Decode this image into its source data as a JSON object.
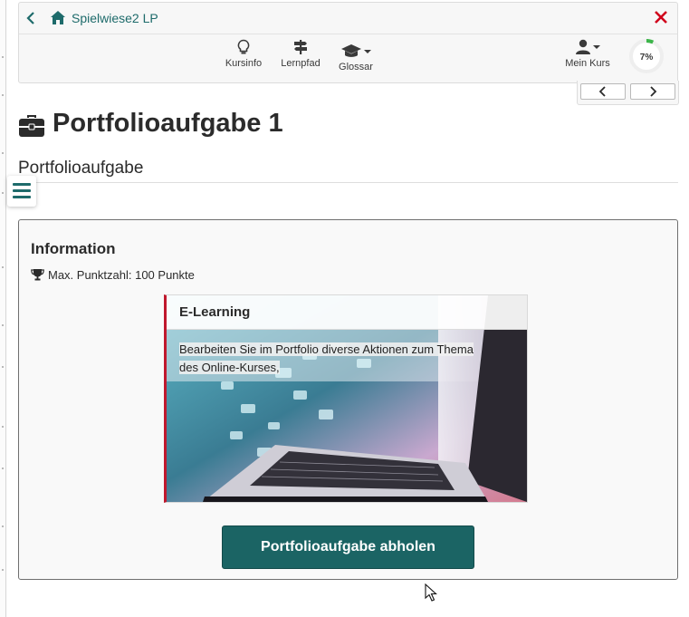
{
  "header": {
    "course_title": "Spielwiese2 LP",
    "toolbar": [
      {
        "label": "Kursinfo",
        "icon": "lightbulb-icon"
      },
      {
        "label": "Lernpfad",
        "icon": "signpost-icon"
      },
      {
        "label": "Glossar",
        "icon": "graduation-cap-icon"
      }
    ],
    "my_course_label": "Mein Kurs",
    "progress_label": "7%",
    "progress_fraction": 0.07,
    "colors": {
      "accent": "#1e6b6b",
      "close": "#d0021b",
      "progress": "#3cb54a"
    }
  },
  "page": {
    "title": "Portfolioaufgabe 1",
    "subtitle": "Portfolioaufgabe"
  },
  "info": {
    "heading": "Information",
    "points": "Max. Punktzahl: 100 Punkte",
    "card": {
      "title": "E-Learning",
      "text_line1": "Bearbeiten Sie im Portfolio diverse Aktionen zum Thema",
      "text_line2": "des Online-Kurses,"
    },
    "button_label": "Portfolioaufgabe abholen"
  }
}
